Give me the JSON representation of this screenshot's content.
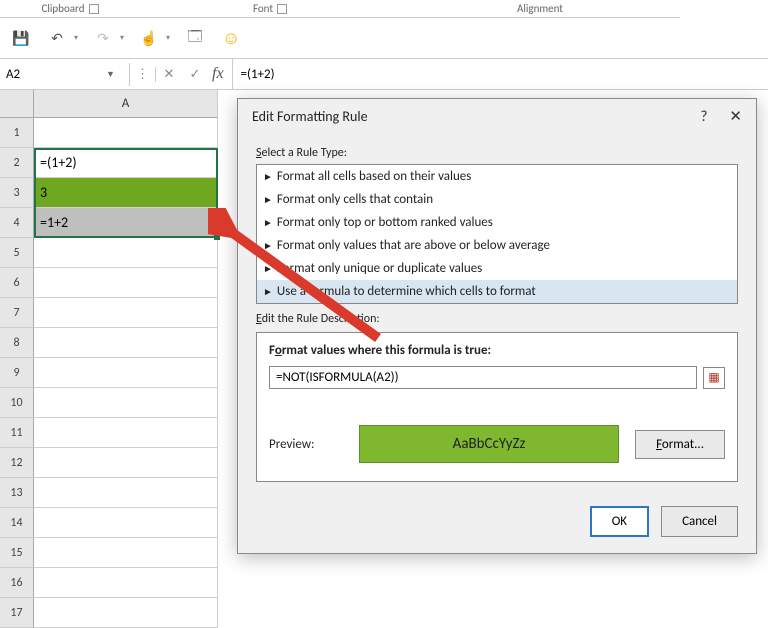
{
  "ribbon_groups": {
    "clipboard": "Clipboard",
    "font": "Font",
    "alignment": "Alignment"
  },
  "namebox": "A2",
  "formula_bar": "=(1+2)",
  "columns": [
    "A"
  ],
  "row_labels": [
    "1",
    "2",
    "3",
    "4",
    "5",
    "6",
    "7",
    "8",
    "9",
    "10",
    "11",
    "12",
    "13",
    "14",
    "15",
    "16",
    "17"
  ],
  "cells": {
    "A1": "",
    "A2": "=(1+2)",
    "A3": "3",
    "A4": "=1+2"
  },
  "dialog": {
    "title": "Edit Formatting Rule",
    "select_label": "Select a Rule Type:",
    "rule_types": [
      "Format all cells based on their values",
      "Format only cells that contain",
      "Format only top or bottom ranked values",
      "Format only values that are above or below average",
      "Format only unique or duplicate values",
      "Use a formula to determine which cells to format"
    ],
    "selected_rule_index": 5,
    "edit_desc_label": "Edit the Rule Description:",
    "formula_title": "Format values where this formula is true:",
    "formula_value": "=NOT(ISFORMULA(A2))",
    "preview_label": "Preview:",
    "preview_sample": "AaBbCcYyZz",
    "format_btn": "Format...",
    "ok": "OK",
    "cancel": "Cancel",
    "preview_bg": "#7fb82e"
  }
}
